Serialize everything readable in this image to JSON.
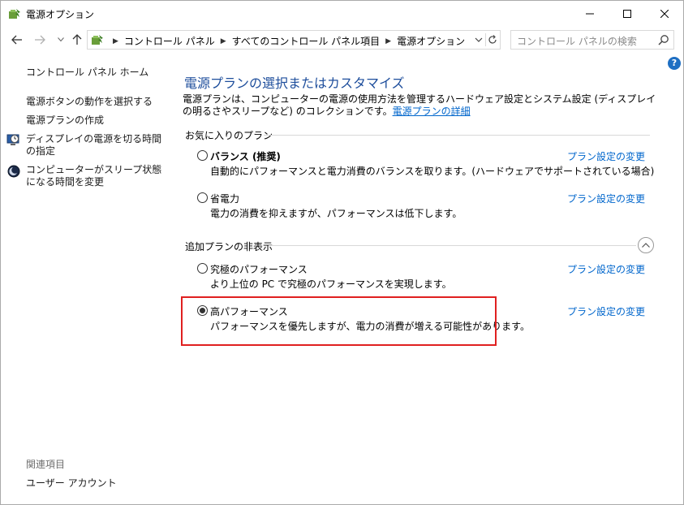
{
  "window": {
    "title": "電源オプション"
  },
  "navigation": {
    "breadcrumbs": [
      "コントロール パネル",
      "すべてのコントロール パネル項目",
      "電源オプション"
    ],
    "search_placeholder": "コントロール パネルの検索"
  },
  "sidebar": {
    "home_link": "コントロール パネル ホーム",
    "links": [
      {
        "label": "電源ボタンの動作を選択する"
      },
      {
        "label": "電源プランの作成"
      },
      {
        "label": "ディスプレイの電源を切る時間の指定"
      },
      {
        "label": "コンピューターがスリープ状態になる時間を変更"
      }
    ],
    "related_header": "関連項目",
    "user_accounts": "ユーザー アカウント"
  },
  "main": {
    "title": "電源プランの選択またはカスタマイズ",
    "description": "電源プランは、コンピューターの電源の使用方法を管理するハードウェア設定とシステム設定 (ディスプレイの明るさやスリープなど) のコレクションです。",
    "description_link": "電源プランの詳細",
    "favorites_header": "お気に入りのプラン",
    "hidden_header": "追加プランの非表示",
    "change_plan_label": "プラン設定の変更",
    "plans": [
      {
        "name": "バランス (推奨)",
        "description": "自動的にパフォーマンスと電力消費のバランスを取ります。(ハードウェアでサポートされている場合)",
        "selected": false
      },
      {
        "name": "省電力",
        "description": "電力の消費を抑えますが、パフォーマンスは低下します。",
        "selected": false
      },
      {
        "name": "究極のパフォーマンス",
        "description": "より上位の PC で究極のパフォーマンスを実現します。",
        "selected": false
      },
      {
        "name": "高パフォーマンス",
        "description": "パフォーマンスを優先しますが、電力の消費が増える可能性があります。",
        "selected": true
      }
    ]
  },
  "colors": {
    "title_blue": "#1e4e9c",
    "link_blue": "#0066cc",
    "highlight_red": "#e02020"
  }
}
